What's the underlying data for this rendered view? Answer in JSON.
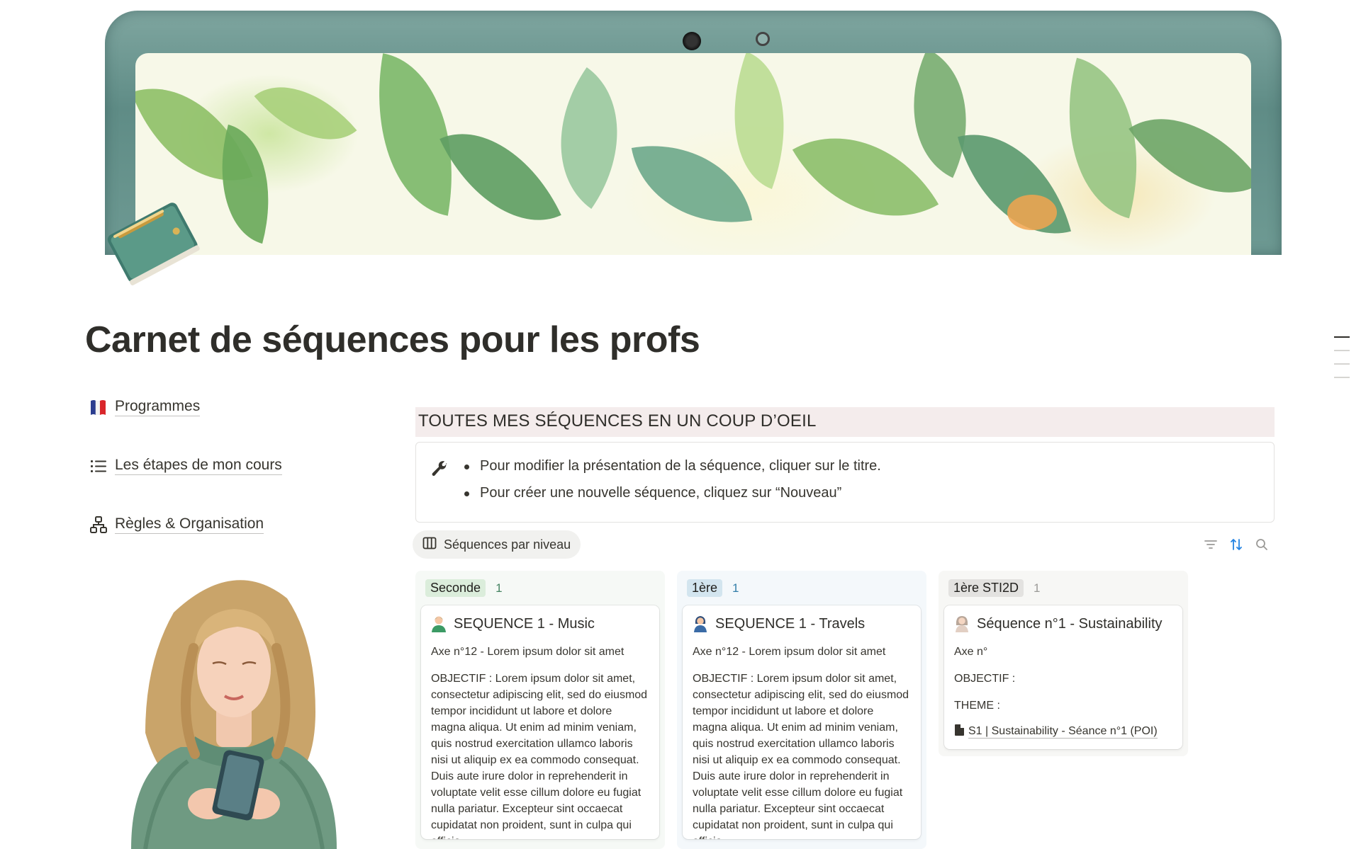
{
  "page": {
    "title": "Carnet de séquences pour les profs",
    "page_icon": "notebook-with-pen-icon",
    "cover": "watercolor-leaves-laptop-cover"
  },
  "nav": [
    {
      "label": "Programmes",
      "icon": "french-flag-icon"
    },
    {
      "label": "Les étapes de mon cours",
      "icon": "list-icon"
    },
    {
      "label": "Règles & Organisation",
      "icon": "hierarchy-icon"
    }
  ],
  "section": {
    "heading": "TOUTES MES SÉQUENCES EN UN COUP D’OEIL",
    "callout_icon": "wrench-icon",
    "callout_items": [
      "Pour modifier la présentation de la séquence, cliquer sur le titre.",
      "Pour créer une nouvelle séquence, cliquez sur “Nouveau”"
    ]
  },
  "view": {
    "tab_label": "Séquences par niveau",
    "tab_icon": "board-icon",
    "tools": [
      "filter-icon",
      "sort-icon",
      "search-icon"
    ]
  },
  "board": {
    "columns": [
      {
        "label": "Seconde",
        "count": "1",
        "colors": {
          "bg": "#f6f9f6",
          "pill": "#dbeddb",
          "count": "#448361"
        },
        "card": {
          "title": "SEQUENCE 1 - Music",
          "avatar": "green-person-icon",
          "axe": "Axe n°12 - Lorem ipsum dolor sit amet",
          "objectif": "OBJECTIF : Lorem ipsum dolor sit amet, consectetur adipiscing elit, sed do eiusmod tempor incididunt ut labore et dolore magna aliqua. Ut enim ad minim veniam, quis nostrud exercitation ullamco laboris nisi ut aliquip ex ea commodo consequat. Duis aute irure dolor in reprehenderit in voluptate velit esse cillum dolore eu fugiat nulla pariatur. Excepteur sint occaecat cupidatat non proident, sunt in culpa qui officia"
        }
      },
      {
        "label": "1ère",
        "count": "1",
        "colors": {
          "bg": "#f4f8fb",
          "pill": "#d3e5ef",
          "count": "#337ea9"
        },
        "card": {
          "title": "SEQUENCE 1 - Travels",
          "avatar": "blue-person-icon",
          "axe": "Axe n°12 - Lorem ipsum dolor sit amet",
          "objectif": "OBJECTIF : Lorem ipsum dolor sit amet, consectetur adipiscing elit, sed do eiusmod tempor incididunt ut labore et dolore magna aliqua. Ut enim ad minim veniam, quis nostrud exercitation ullamco laboris nisi ut aliquip ex ea commodo consequat. Duis aute irure dolor in reprehenderit in voluptate velit esse cillum dolore eu fugiat nulla pariatur. Excepteur sint occaecat cupidatat non proident, sunt in culpa qui officia"
        }
      },
      {
        "label": "1ère STI2D",
        "count": "1",
        "colors": {
          "bg": "#f7f7f5",
          "pill": "#e3e2e0",
          "count": "#9b9a97"
        },
        "card": {
          "title": "Séquence n°1 - Sustainability",
          "avatar": "beige-person-icon",
          "axe": "Axe n°",
          "objectif": "OBJECTIF :",
          "theme": "THEME :",
          "relation": "S1 | Sustainability - Séance n°1 (POI)",
          "relation_icon": "page-icon"
        }
      }
    ]
  }
}
